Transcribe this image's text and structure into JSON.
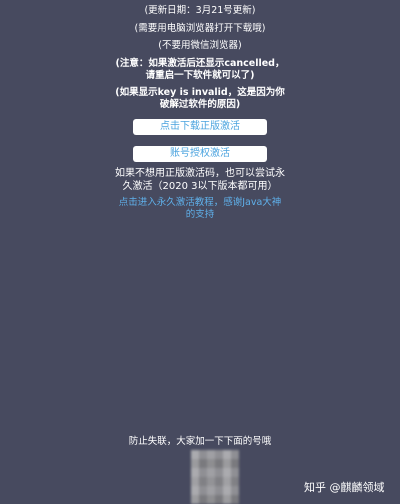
{
  "notes": {
    "update_date": "(更新日期：3月21号更新)",
    "open_in_browser": "(需要用电脑浏览器打开下载哦)",
    "no_wechat": "(不要用微信浏览器)",
    "notice_line1": "(注意：如果激活后还显示cancelled，",
    "notice_line2": "请重启一下软件就可以了)",
    "invalid_line1": "(如果显示key is invalid，这是因为你",
    "invalid_line2": "破解过软件的原因)"
  },
  "buttons": {
    "download_official": "点击下载正版激活",
    "account_auth": "账号授权激活"
  },
  "alt_text": {
    "line1": "如果不想用正版激活码，也可以尝试永",
    "line2": "久激活（2020 3以下版本都可用）"
  },
  "link": {
    "line1": "点击进入永久激活教程，感谢Java大神",
    "line2": "的支持"
  },
  "footer": {
    "prevent_loss": "防止失联，大家加一下下面的号哦",
    "watermark": "知乎 @麒麟领域"
  }
}
